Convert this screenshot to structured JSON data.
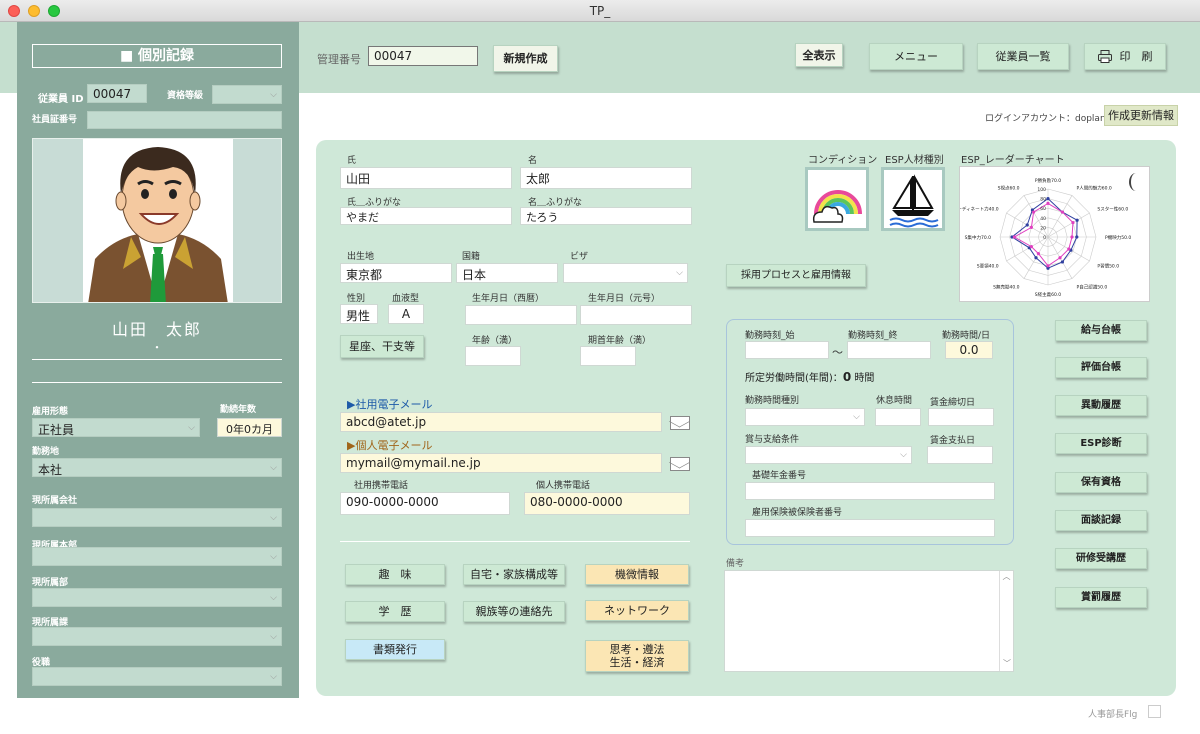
{
  "window": {
    "title": "TP_"
  },
  "header": {
    "mgmt_label": "管理番号",
    "mgmt_value": "00047",
    "new_button": "新規作成",
    "show_all": "全表示",
    "menu": "メニュー",
    "employee_list": "従業員一覧",
    "print": "印　刷",
    "login_account": "ログインアカウント：doplan",
    "update_info": "作成更新情報"
  },
  "sidebar": {
    "title": "■ 個別記録",
    "employee_id_label": "従業員 ID",
    "employee_id": "00047",
    "grade_label": "資格等級",
    "grade_value": "",
    "card_no_label": "社員証番号",
    "card_no": "",
    "photo_icon": "employee-portrait",
    "full_name": "山田　太郎",
    "sub_name": "・",
    "employment_type_label": "雇用形態",
    "employment_type": "正社員",
    "years_label": "勤続年数",
    "years_value": "0年0カ月",
    "workplace_label": "勤務地",
    "workplace": "本社",
    "company_label": "現所属会社",
    "company": "",
    "hq_label": "現所属本部",
    "hq": "",
    "dept_label": "現所属部",
    "dept": "",
    "section_label": "現所属課",
    "section": "",
    "position_label": "役職",
    "position": ""
  },
  "form": {
    "last_name_label": "氏",
    "last_name": "山田",
    "first_name_label": "名",
    "first_name": "太郎",
    "last_kana_label": "氏＿ふりがな",
    "last_kana": "やまだ",
    "first_kana_label": "名＿ふりがな",
    "first_kana": "たろう",
    "birthplace_label": "出生地",
    "birthplace": "東京都",
    "nationality_label": "国籍",
    "nationality": "日本",
    "visa_label": "ビザ",
    "visa": "",
    "gender_label": "性別",
    "gender": "男性",
    "blood_label": "血液型",
    "blood": "A",
    "dob_west_label": "生年月日（西暦）",
    "dob_west": "",
    "dob_era_label": "生年月日（元号）",
    "dob_era": "",
    "zodiac_button": "星座、干支等",
    "age_label": "年齢（満）",
    "age": "",
    "term_age_label": "期首年齢（満）",
    "term_age": "",
    "work_email_label": "▶社用電子メール",
    "work_email": "abcd@atet.jp",
    "personal_email_label": "▶個人電子メール",
    "personal_email": "mymail@mymail.ne.jp",
    "work_phone_label": "社用携帯電話",
    "work_phone": "090-0000-0000",
    "personal_phone_label": "個人携帯電話",
    "personal_phone": "080-0000-0000"
  },
  "buttons": {
    "hobby": "趣　味",
    "home_family": "自宅・家族構成等",
    "confidential": "機微情報",
    "education": "学　歴",
    "relatives": "親族等の連絡先",
    "network": "ネットワーク",
    "documents": "書類発行",
    "thinking_1": "思考・遵法",
    "thinking_2": "生活・経済",
    "hiring": "採用プロセスと雇用情報"
  },
  "esp": {
    "condition_label": "コンディション",
    "condition_icon": "rainbow-cloud-icon",
    "type_label": "ESP人材種別",
    "type_icon": "sailboat-icon",
    "radar_label": "ESP_レーダーチャート"
  },
  "work": {
    "start_label": "勤務時刻_始",
    "start": "",
    "tilde": "～",
    "end_label": "勤務時刻_終",
    "end": "",
    "hours_label": "勤務時間/日",
    "hours": "0.0",
    "annual_label": "所定労働時間(年間)：",
    "annual_value": "0",
    "annual_unit": "時間",
    "type_label": "勤務時間種別",
    "type": "",
    "break_label": "休息時間",
    "break": "",
    "cutoff_label": "賃金締切日",
    "cutoff": "",
    "bonus_label": "賞与支給条件",
    "bonus": "",
    "payday_label": "賃金支払日",
    "payday": "",
    "pension_label": "基礎年金番号",
    "pension": "",
    "insurance_label": "雇用保険被保険者番号",
    "insurance": ""
  },
  "notes": {
    "label": "備考",
    "value": ""
  },
  "right_buttons": [
    "給与台帳",
    "評価台帳",
    "異動履歴",
    "ESP診断",
    "保有資格",
    "面談記録",
    "研修受講歴",
    "賞罰履歴"
  ],
  "footer": {
    "hr_flag": "人事部長Flg"
  },
  "radar": {
    "labels": [
      "P勝負勘70.0",
      "P人間的魅力60.0",
      "Sスター性60.0",
      "P機映力50.0",
      "P習慣50.0",
      "P自己認識50.0",
      "S経主義60.0",
      "S無売勘40.0",
      "S要領40.0",
      "S集中力70.0",
      "Sコーディネート力40.0",
      "S視点60.0"
    ],
    "values_blue": [
      80,
      60,
      70,
      60,
      55,
      60,
      65,
      50,
      45,
      75,
      50,
      65
    ],
    "values_pink": [
      70,
      60,
      60,
      50,
      50,
      50,
      60,
      40,
      40,
      70,
      40,
      60
    ],
    "scale_labels": [
      "100",
      "80",
      "60",
      "40",
      "20",
      "0"
    ],
    "colors": {
      "blue": "#3040a0",
      "pink": "#e040c0"
    }
  }
}
